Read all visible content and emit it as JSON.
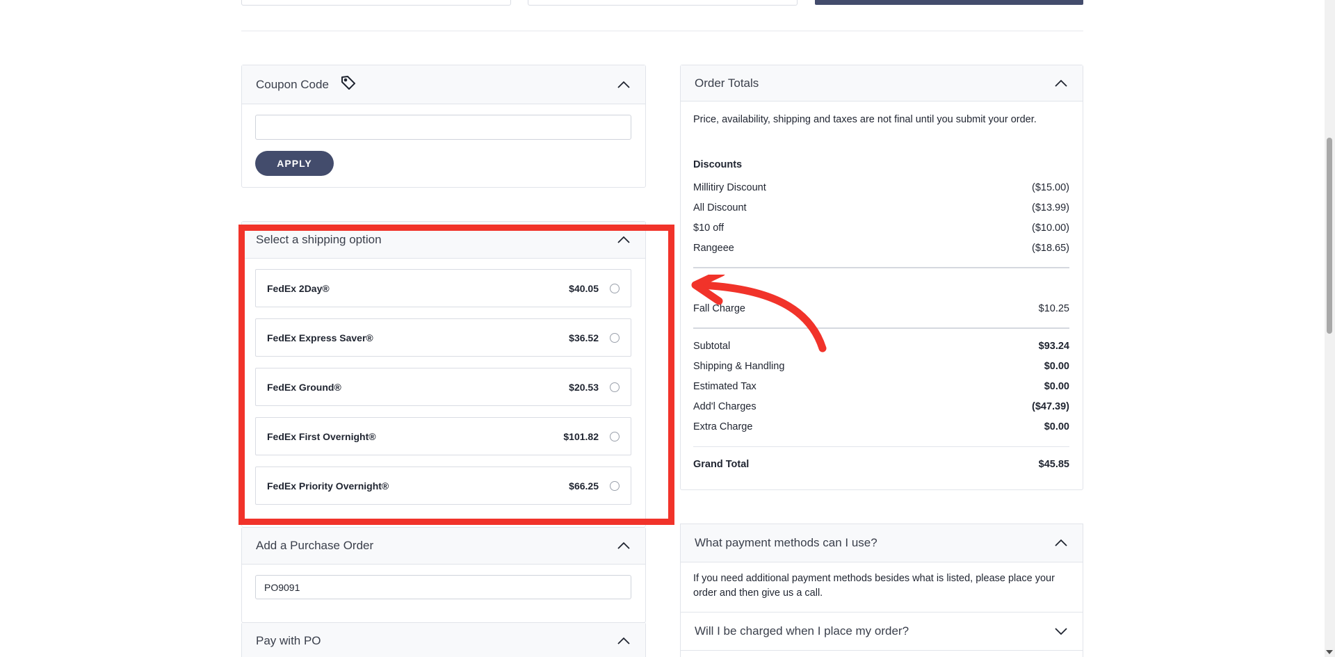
{
  "coupon": {
    "title": "Coupon Code",
    "input_value": "",
    "apply_label": "APPLY"
  },
  "shipping": {
    "title": "Select a shipping option",
    "options": [
      {
        "name": "FedEx 2Day®",
        "price": "$40.05"
      },
      {
        "name": "FedEx Express Saver®",
        "price": "$36.52"
      },
      {
        "name": "FedEx Ground®",
        "price": "$20.53"
      },
      {
        "name": "FedEx First Overnight®",
        "price": "$101.82"
      },
      {
        "name": "FedEx Priority Overnight®",
        "price": "$66.25"
      }
    ]
  },
  "purchase_order": {
    "title": "Add a Purchase Order",
    "value": "PO9091"
  },
  "pay_with_po": {
    "title": "Pay with PO"
  },
  "order_totals": {
    "title": "Order Totals",
    "notice": "Price, availability, shipping and taxes are not final until you submit your order.",
    "discounts_heading": "Discounts",
    "discounts": [
      {
        "label": "Millitiry Discount",
        "amount": "($15.00)"
      },
      {
        "label": "All Discount",
        "amount": "($13.99)"
      },
      {
        "label": "$10 off",
        "amount": "($10.00)"
      },
      {
        "label": "Rangeee",
        "amount": "($18.65)"
      }
    ],
    "charges": [
      {
        "label": "Fall Charge",
        "amount": "$10.25"
      }
    ],
    "summary": [
      {
        "label": "Subtotal",
        "amount": "$93.24"
      },
      {
        "label": "Shipping & Handling",
        "amount": "$0.00"
      },
      {
        "label": "Estimated Tax",
        "amount": "$0.00"
      },
      {
        "label": "Add'l Charges",
        "amount": "($47.39)"
      },
      {
        "label": "Extra Charge",
        "amount": "$0.00"
      }
    ],
    "grand_total_label": "Grand Total",
    "grand_total": "$45.85"
  },
  "faq": {
    "q1": "What payment methods can I use?",
    "a1": "If you need additional payment methods besides what is listed, please place your order and then give us a call.",
    "q2": "Will I be charged when I place my order?"
  },
  "colors": {
    "highlight": "#f1332a",
    "primary_button": "#434c6c"
  }
}
